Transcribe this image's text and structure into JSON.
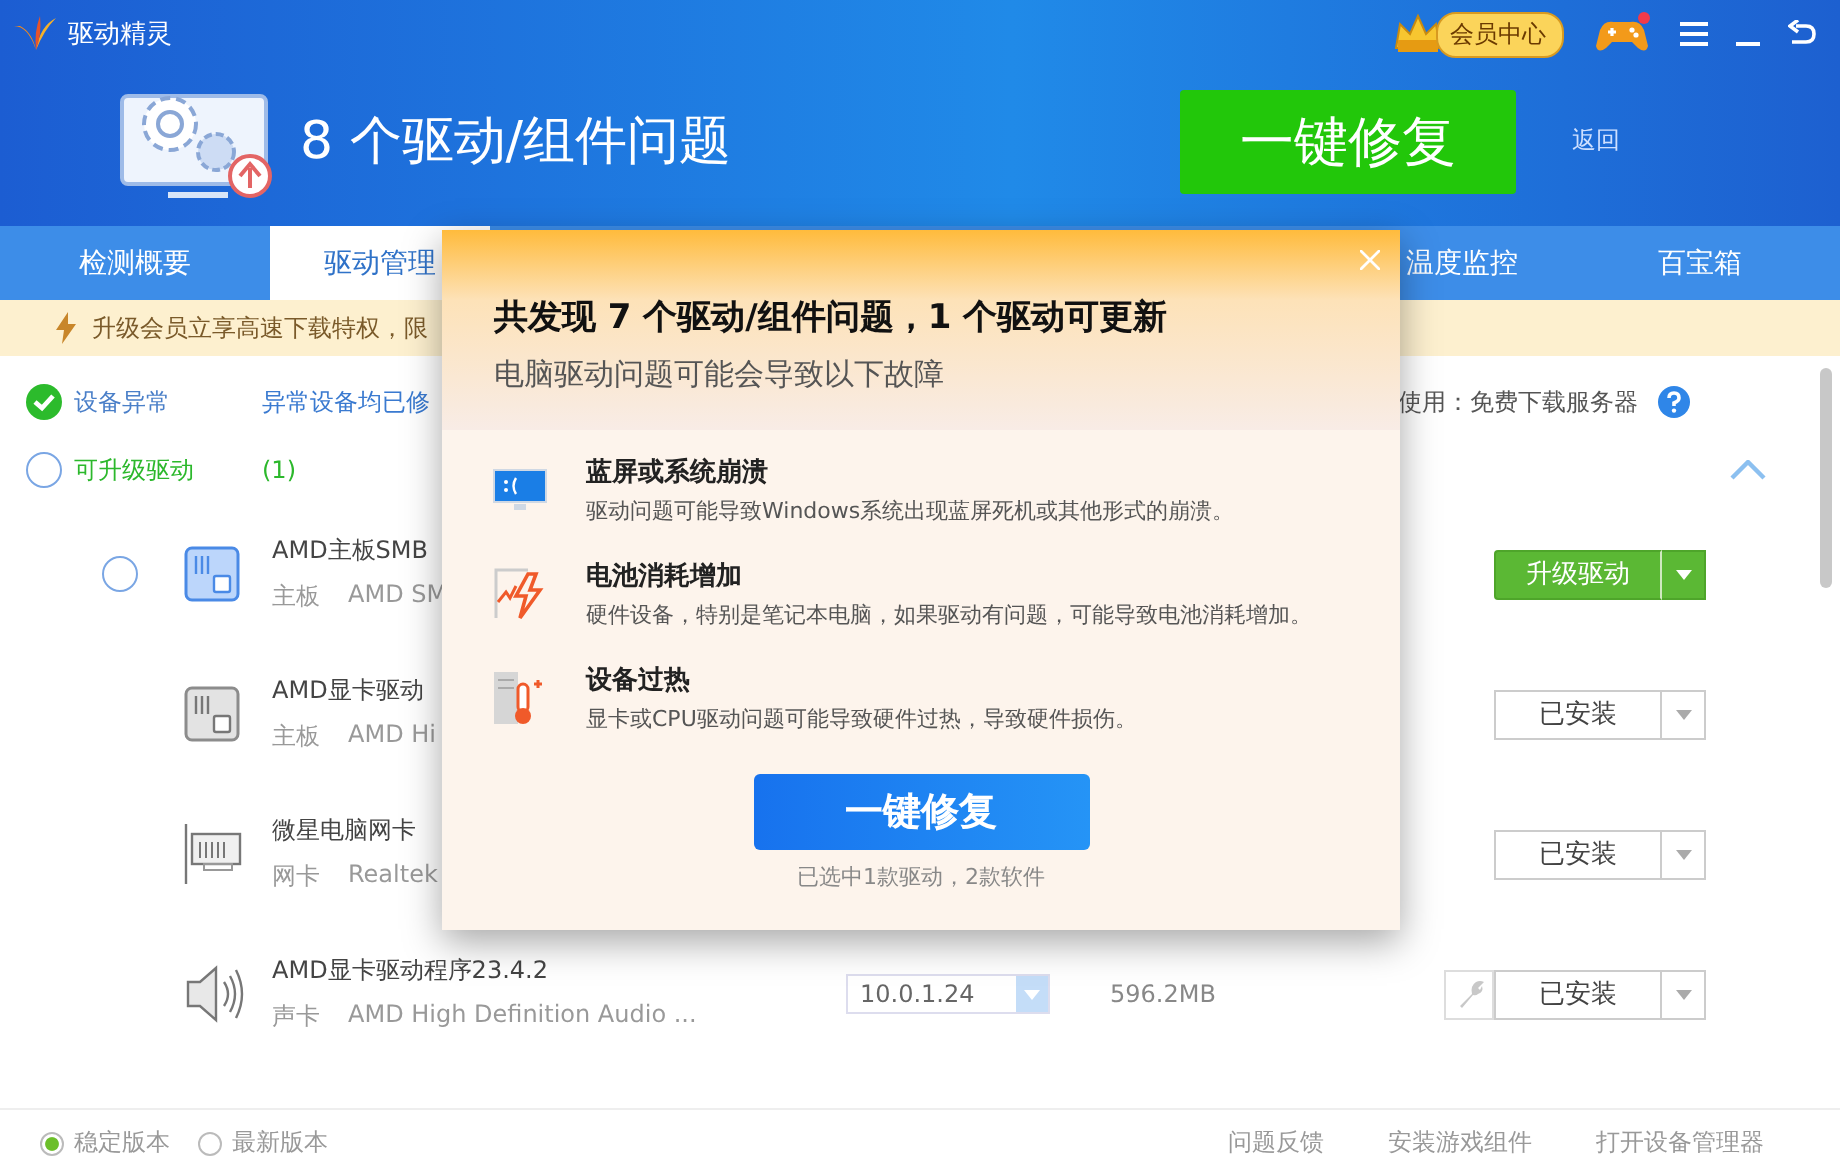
{
  "app": {
    "name": "驱动精灵",
    "vip": "会员中心"
  },
  "header": {
    "title": "8 个驱动/组件问题",
    "fix_button": "一键修复",
    "back": "返回"
  },
  "tabs": [
    {
      "label": "检测概要",
      "selected": false
    },
    {
      "label": "驱动管理",
      "selected": true
    },
    {
      "label": "温度监控",
      "selected": false
    },
    {
      "label": "百宝箱",
      "selected": false
    }
  ],
  "banner": "升级会员立享高速下载特权，限",
  "status": {
    "abnormal": {
      "label": "设备异常",
      "note": "异常设备均已修",
      "checked": true
    },
    "server": "使用：免费下载服务器",
    "upgradable": {
      "label": "可升级驱动",
      "count": "(1)",
      "selected": false,
      "expanded": true
    }
  },
  "drivers": [
    {
      "kind": "board",
      "upgradable": true,
      "selected": false,
      "name": "AMD主板SMB",
      "category": "主板",
      "description": "AMD SM",
      "action": "升级驱动",
      "wrench": false
    },
    {
      "kind": "board",
      "upgradable": false,
      "name": "AMD显卡驱动",
      "category": "主板",
      "description": "AMD Hi",
      "action": "已安装",
      "wrench": false
    },
    {
      "kind": "network",
      "upgradable": false,
      "name": "微星电脑网卡",
      "category": "网卡",
      "description": "Realtek",
      "action": "已安装",
      "wrench": false
    },
    {
      "kind": "audio",
      "upgradable": false,
      "name": "AMD显卡驱动程序23.4.2",
      "category": "声卡",
      "description": "AMD High Definition Audio ...",
      "version": "10.0.1.24",
      "size": "596.2MB",
      "action": "已安装",
      "wrench": true
    }
  ],
  "popup": {
    "title": "共发现 7 个驱动/组件问题，1 个驱动可更新",
    "subtitle": "电脑驱动问题可能会导致以下故障",
    "issues": [
      {
        "kind": "bluescreen",
        "title": "蓝屏或系统崩溃",
        "text": "驱动问题可能导致Windows系统出现蓝屏死机或其他形式的崩溃。"
      },
      {
        "kind": "battery",
        "title": "电池消耗增加",
        "text": "硬件设备，特别是笔记本电脑，如果驱动有问题，可能导致电池消耗增加。"
      },
      {
        "kind": "heat",
        "title": "设备过热",
        "text": "显卡或CPU驱动问题可能导致硬件过热，导致硬件损伤。"
      }
    ],
    "button": "一键修复",
    "note": "已选中1款驱动，2款软件"
  },
  "footer": {
    "versions": [
      {
        "label": "稳定版本",
        "selected": true
      },
      {
        "label": "最新版本",
        "selected": false
      }
    ],
    "links": [
      "问题反馈",
      "安装游戏组件",
      "打开设备管理器"
    ]
  }
}
